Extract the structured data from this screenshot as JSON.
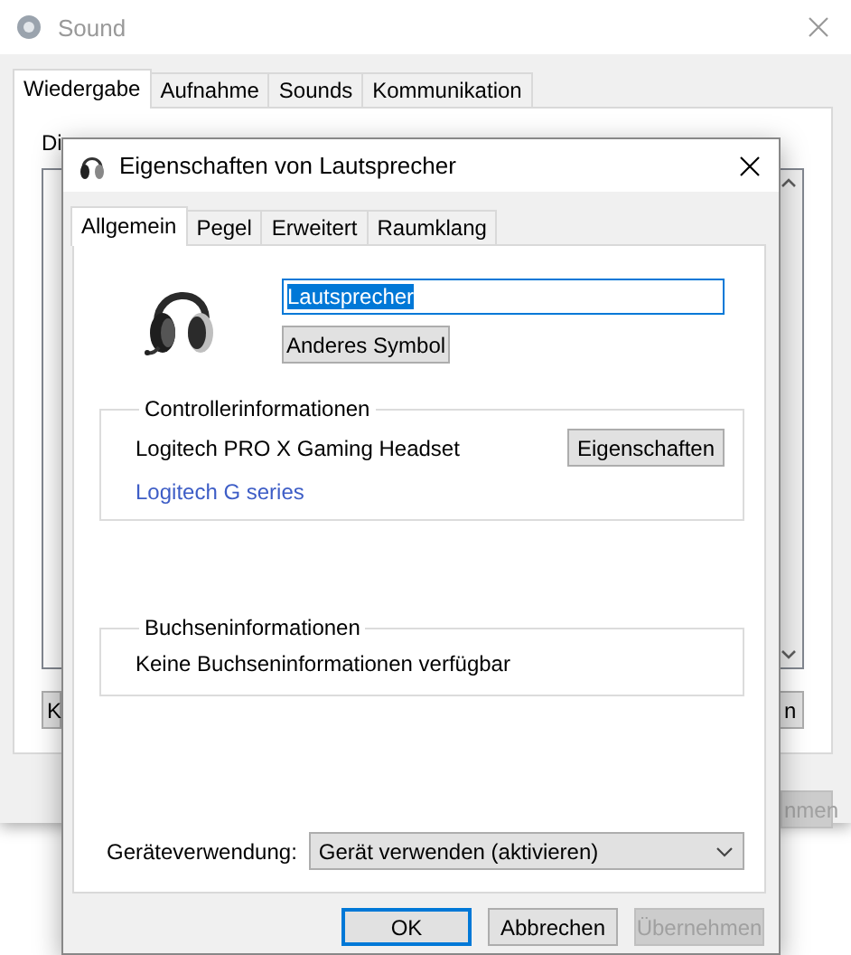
{
  "sound_window": {
    "title": "Sound",
    "tabs": [
      {
        "label": "Wiedergabe",
        "selected": true
      },
      {
        "label": "Aufnahme",
        "selected": false
      },
      {
        "label": "Sounds",
        "selected": false
      },
      {
        "label": "Kommunikation",
        "selected": false
      }
    ],
    "intro_text": "Di",
    "left_button": "K",
    "right_button": "n",
    "apply_button": {
      "label": "nmen",
      "disabled": true
    }
  },
  "dialog": {
    "title": "Eigenschaften von Lautsprecher",
    "tabs": [
      {
        "label": "Allgemein",
        "selected": true
      },
      {
        "label": "Pegel",
        "selected": false
      },
      {
        "label": "Erweitert",
        "selected": false
      },
      {
        "label": "Raumklang",
        "selected": false
      }
    ],
    "name_field": {
      "value": "Lautsprecher",
      "text_selected": true
    },
    "change_icon_button": "Anderes Symbol",
    "controller_group": {
      "title": "Controllerinformationen",
      "device": "Logitech PRO X Gaming Headset",
      "properties_button": "Eigenschaften",
      "link": "Logitech G series"
    },
    "jack_group": {
      "title": "Buchseninformationen",
      "text": "Keine Buchseninformationen verfügbar"
    },
    "device_usage": {
      "label": "Geräteverwendung:",
      "value": "Gerät verwenden (aktivieren)"
    },
    "buttons": [
      {
        "label": "OK",
        "focused": true,
        "disabled": false
      },
      {
        "label": "Abbrechen",
        "focused": false,
        "disabled": false
      },
      {
        "label": "Übernehmen",
        "focused": false,
        "disabled": true
      }
    ]
  }
}
